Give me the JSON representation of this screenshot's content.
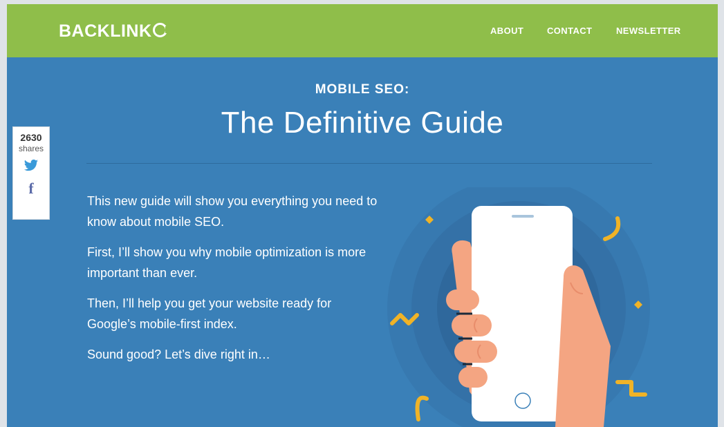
{
  "header": {
    "logo": "BACKLINK",
    "nav": [
      "ABOUT",
      "CONTACT",
      "NEWSLETTER"
    ]
  },
  "hero": {
    "kicker": "MOBILE SEO:",
    "title": "The Definitive Guide"
  },
  "intro": [
    "This new guide will show you everything you need to know about mobile SEO.",
    "First, I’ll show you why mobile optimization is more important than ever.",
    "Then, I’ll help you get your website ready for Google’s mobile-first index.",
    "Sound good? Let’s dive right in…"
  ],
  "share": {
    "count": "2630",
    "label": "shares",
    "twitter_icon": "twitter-icon",
    "facebook_icon": "facebook-icon",
    "facebook_glyph": "f"
  },
  "colors": {
    "header_green": "#8fbe4a",
    "hero_blue": "#3a80b8",
    "accent_yellow": "#f0b327",
    "skin": "#f4a582"
  }
}
